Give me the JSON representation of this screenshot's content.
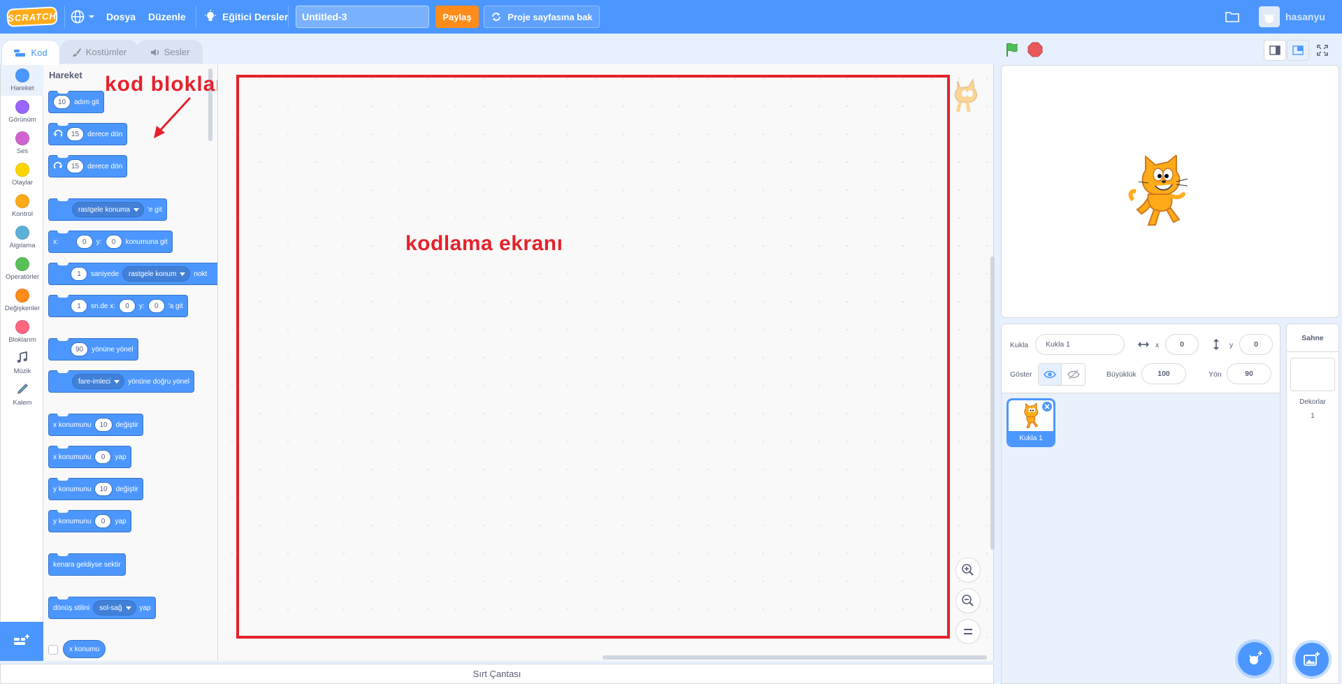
{
  "menubar": {
    "logo": "SCRATCH",
    "file": "Dosya",
    "edit": "Düzenle",
    "tutorials": "Eğitici Dersler",
    "project_title": "Untitled-3",
    "share": "Paylaş",
    "see_project": "Proje sayfasına bak",
    "username": "hasanyu"
  },
  "tabs": {
    "code": "Kod",
    "costumes": "Kostümler",
    "sounds": "Sesler"
  },
  "categories": [
    {
      "label": "Hareket",
      "color": "#4c97ff"
    },
    {
      "label": "Görünüm",
      "color": "#9966ff"
    },
    {
      "label": "Ses",
      "color": "#cf63cf"
    },
    {
      "label": "Olaylar",
      "color": "#ffd500"
    },
    {
      "label": "Kontrol",
      "color": "#ffab19"
    },
    {
      "label": "Algılama",
      "color": "#5cb1d6"
    },
    {
      "label": "Operatörler",
      "color": "#59c059"
    },
    {
      "label": "Değişkenler",
      "color": "#ff8c1a"
    },
    {
      "label": "Bloklarım",
      "color": "#ff6680"
    },
    {
      "label": "Müzik",
      "color": "",
      "icon": "music-icon"
    },
    {
      "label": "Kalem",
      "color": "",
      "icon": "pen-icon"
    }
  ],
  "palette": {
    "title": "Hareket",
    "blocks": {
      "move": {
        "value": "10",
        "text": "adım git"
      },
      "turn_right": {
        "value": "15",
        "text": "derece dön"
      },
      "turn_left": {
        "value": "15",
        "text": "derece dön"
      },
      "goto": {
        "drop": "rastgele konuma",
        "text": "'e git"
      },
      "goto_xy": {
        "x_label": "x:",
        "x": "0",
        "y_label": "y:",
        "y": "0",
        "text": "konumuna git"
      },
      "glide_to": {
        "value": "1",
        "text1": "saniyede",
        "drop": "rastgele konum",
        "text2": "nokt"
      },
      "glide_xy": {
        "value": "1",
        "text1": "sn.de x:",
        "x": "0",
        "y_label": "y:",
        "y": "0",
        "text2": "'a git"
      },
      "point_dir": {
        "value": "90",
        "text": "yönüne yönel"
      },
      "point_towards": {
        "drop": "fare-imleci",
        "text": "yönüne doğru yönel"
      },
      "change_x": {
        "text1": "x konumunu",
        "value": "10",
        "text2": "değiştir"
      },
      "set_x": {
        "text1": "x konumunu",
        "value": "0",
        "text2": "yap"
      },
      "change_y": {
        "text1": "y konumunu",
        "value": "10",
        "text2": "değiştir"
      },
      "set_y": {
        "text1": "y konumunu",
        "value": "0",
        "text2": "yap"
      },
      "bounce": {
        "text": "kenara geldiyse sektir"
      },
      "rotation": {
        "text1": "dönüş stilini",
        "drop": "sol-sağ",
        "text2": "yap"
      }
    },
    "reporter": "x konumu"
  },
  "annotations": {
    "blocks_label": "kod  blokları",
    "code_label": "kodlama ekranı"
  },
  "backpack": "Sırt Çantası",
  "sprite_info": {
    "sprite_label": "Kukla",
    "sprite_name": "Kukla 1",
    "x_label": "x",
    "x": "0",
    "y_label": "y",
    "y": "0",
    "show_label": "Göster",
    "size_label": "Büyüklük",
    "size": "100",
    "direction_label": "Yön",
    "direction": "90"
  },
  "sprites": [
    {
      "name": "Kukla 1"
    }
  ],
  "stage_panel": {
    "title": "Sahne",
    "backdrops_label": "Dekorlar",
    "backdrops_count": "1"
  },
  "colors": {
    "accent": "#4c97ff",
    "share": "#ff8c1a",
    "annotation": "#e5222c"
  }
}
